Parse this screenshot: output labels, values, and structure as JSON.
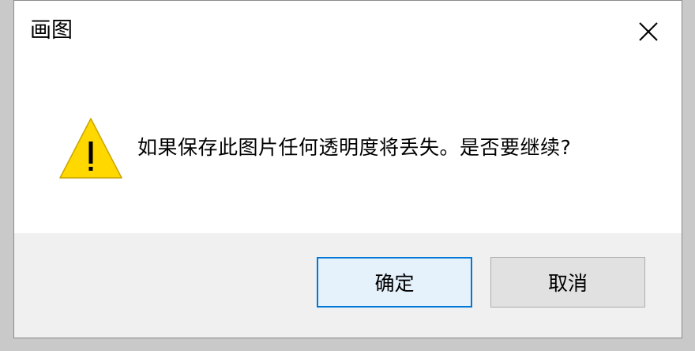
{
  "window": {
    "title": "画图",
    "close_icon": "close-icon"
  },
  "message": {
    "icon": "warning-icon",
    "text": "如果保存此图片任何透明度将丢失。是否要继续?"
  },
  "buttons": {
    "ok_label": "确定",
    "cancel_label": "取消"
  },
  "colors": {
    "warning_fill": "#ffd800",
    "ok_border": "#0078d7",
    "ok_background": "#e5f1fb",
    "footer_background": "#f0f0f0"
  }
}
